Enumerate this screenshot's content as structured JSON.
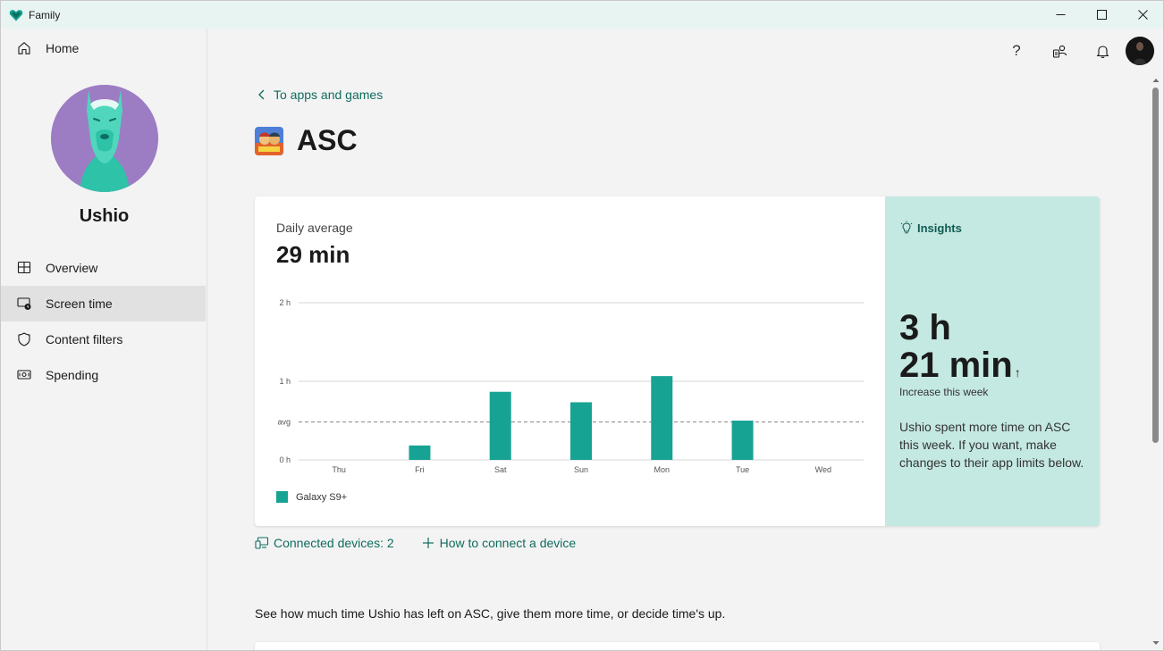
{
  "window": {
    "title": "Family",
    "controls": [
      "minimize",
      "maximize",
      "close"
    ]
  },
  "sidebar": {
    "home_label": "Home",
    "profile_name": "Ushio",
    "items": [
      {
        "label": "Overview",
        "icon": "overview-icon",
        "active": false
      },
      {
        "label": "Screen time",
        "icon": "screen-time-icon",
        "active": true
      },
      {
        "label": "Content filters",
        "icon": "shield-icon",
        "active": false
      },
      {
        "label": "Spending",
        "icon": "spending-icon",
        "active": false
      }
    ]
  },
  "topbar": {
    "icons": [
      "help-icon",
      "family-switch-icon",
      "notifications-icon",
      "user-avatar"
    ],
    "help_glyph": "?"
  },
  "page": {
    "back_label": "To apps and games",
    "app_name": "ASC"
  },
  "usage": {
    "daily_label": "Daily average",
    "daily_value": "29 min",
    "legend_label": "Galaxy S9+"
  },
  "chart_data": {
    "type": "bar",
    "categories": [
      "Thu",
      "Fri",
      "Sat",
      "Sun",
      "Mon",
      "Tue",
      "Wed"
    ],
    "series": [
      {
        "name": "Galaxy S9+",
        "values": [
          0,
          11,
          52,
          44,
          64,
          30,
          0
        ]
      }
    ],
    "y_unit": "min",
    "y_ticks": [
      {
        "label": "0 h",
        "value": 0
      },
      {
        "label": "avg",
        "value": 29
      },
      {
        "label": "1 h",
        "value": 60
      },
      {
        "label": "2 h",
        "value": 120
      }
    ],
    "avg_value": 29,
    "ylim": [
      0,
      120
    ],
    "bar_color": "#17a393",
    "avg_line": "dashed"
  },
  "insights": {
    "title": "Insights",
    "big_line1": "3 h",
    "big_line2": "21 min",
    "arrow": "↑",
    "sub": "Increase this week",
    "text": "Ushio spent more time on ASC this week. If you want, make changes to their app limits below."
  },
  "devices": {
    "connected_label": "Connected devices: 2",
    "how_to_label": "How to connect a device"
  },
  "description": "See how much time Ushio has left on ASC, give them more time, or decide time's up.",
  "colors": {
    "accent": "#0f6c5f",
    "bar": "#17a393",
    "insights_bg": "#c4e8e2",
    "titlebar_bg": "#e8f4f2"
  }
}
